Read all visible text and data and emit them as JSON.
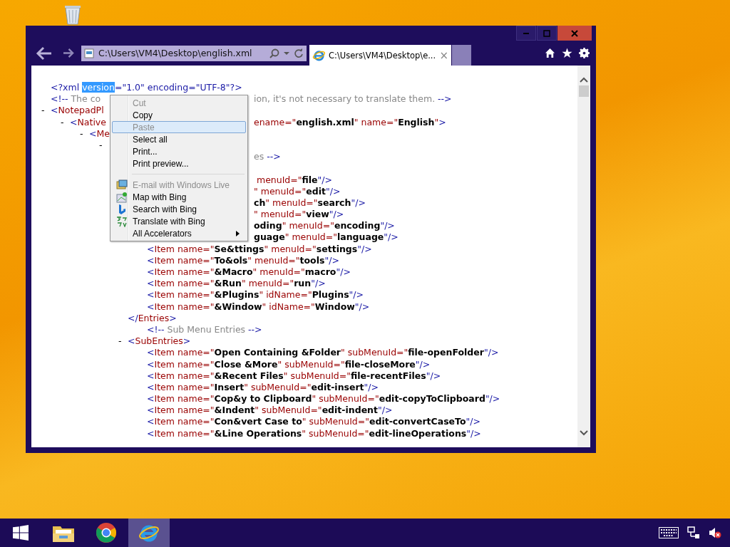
{
  "browser": {
    "address": "C:\\Users\\VM4\\Desktop\\english.xml",
    "tabs": [
      {
        "title": "C:\\Users\\VM4\\Desktop\\e...",
        "close": "×",
        "selected": true
      }
    ]
  },
  "document": {
    "nodes": [
      {
        "tokens": [
          {
            "kind": "markup",
            "text": "<?xml "
          },
          {
            "kind": "selection",
            "text": "version"
          },
          {
            "kind": "markup",
            "text": "=\"1.0\" encoding=\"UTF-8\"?>"
          }
        ]
      },
      {
        "tokens": [
          {
            "kind": "markup",
            "text": "<!--"
          },
          {
            "kind": "comment",
            "text": " The co"
          }
        ],
        "post": [
          {
            "kind": "comment",
            "text": "ion, it's not necessary to translate them. "
          },
          {
            "kind": "markup",
            "text": "-->"
          }
        ]
      },
      {
        "toggle": "-",
        "tokens": [
          {
            "kind": "markup",
            "text": "<"
          },
          {
            "kind": "name",
            "text": "NotepadPl"
          }
        ],
        "children": [
          {
            "toggle": "-",
            "tokens": [
              {
                "kind": "markup",
                "text": "<"
              },
              {
                "kind": "name",
                "text": "Native"
              }
            ],
            "post": [
              {
                "kind": "name",
                "text": "ename=\""
              },
              {
                "kind": "value",
                "text": "english.xml"
              },
              {
                "kind": "name",
                "text": "\" name=\""
              },
              {
                "kind": "value",
                "text": "English"
              },
              {
                "kind": "name",
                "text": "\""
              },
              {
                "kind": "markup",
                "text": ">"
              }
            ],
            "children": [
              {
                "toggle": "-",
                "tokens": [
                  {
                    "kind": "markup",
                    "text": "<"
                  },
                  {
                    "kind": "name",
                    "text": "Me"
                  }
                ],
                "children": [
                  {
                    "toggle": "-",
                    "children": [
                      {
                        "kind": "comment",
                        "post": [
                          {
                            "kind": "comment",
                            "text": "es "
                          },
                          {
                            "kind": "markup",
                            "text": "-->"
                          }
                        ]
                      },
                      {
                        "children": [
                          {
                            "post": [
                              {
                                "kind": "name",
                                "text": " menuId=\""
                              },
                              {
                                "kind": "value",
                                "text": "file"
                              },
                              {
                                "kind": "markup",
                                "text": "\"/>"
                              }
                            ]
                          },
                          {
                            "post": [
                              {
                                "kind": "name",
                                "text": "\" menuId=\""
                              },
                              {
                                "kind": "value",
                                "text": "edit"
                              },
                              {
                                "kind": "markup",
                                "text": "\"/>"
                              }
                            ]
                          },
                          {
                            "post": [
                              {
                                "kind": "value",
                                "text": "ch"
                              },
                              {
                                "kind": "name",
                                "text": "\" menuId=\""
                              },
                              {
                                "kind": "value",
                                "text": "search"
                              },
                              {
                                "kind": "markup",
                                "text": "\"/>"
                              }
                            ]
                          },
                          {
                            "post": [
                              {
                                "kind": "name",
                                "text": "\" menuId=\""
                              },
                              {
                                "kind": "value",
                                "text": "view"
                              },
                              {
                                "kind": "markup",
                                "text": "\"/>"
                              }
                            ]
                          },
                          {
                            "post": [
                              {
                                "kind": "value",
                                "text": "oding"
                              },
                              {
                                "kind": "name",
                                "text": "\" menuId=\""
                              },
                              {
                                "kind": "value",
                                "text": "encoding"
                              },
                              {
                                "kind": "markup",
                                "text": "\"/>"
                              }
                            ]
                          },
                          {
                            "post": [
                              {
                                "kind": "value",
                                "text": "guage"
                              },
                              {
                                "kind": "name",
                                "text": "\" menuId=\""
                              },
                              {
                                "kind": "value",
                                "text": "language"
                              },
                              {
                                "kind": "markup",
                                "text": "\"/>"
                              }
                            ]
                          },
                          {
                            "tokens": [
                              {
                                "kind": "markup",
                                "text": "<"
                              },
                              {
                                "kind": "name",
                                "text": "Item name=\""
                              },
                              {
                                "kind": "value",
                                "text": "Se&ttings"
                              },
                              {
                                "kind": "name",
                                "text": "\" menuId=\""
                              },
                              {
                                "kind": "value",
                                "text": "settings"
                              },
                              {
                                "kind": "markup",
                                "text": "\"/>"
                              }
                            ]
                          },
                          {
                            "tokens": [
                              {
                                "kind": "markup",
                                "text": "<"
                              },
                              {
                                "kind": "name",
                                "text": "Item name=\""
                              },
                              {
                                "kind": "value",
                                "text": "To&ols"
                              },
                              {
                                "kind": "name",
                                "text": "\" menuId=\""
                              },
                              {
                                "kind": "value",
                                "text": "tools"
                              },
                              {
                                "kind": "markup",
                                "text": "\"/>"
                              }
                            ]
                          },
                          {
                            "tokens": [
                              {
                                "kind": "markup",
                                "text": "<"
                              },
                              {
                                "kind": "name",
                                "text": "Item name=\""
                              },
                              {
                                "kind": "value",
                                "text": "&Macro"
                              },
                              {
                                "kind": "name",
                                "text": "\" menuId=\""
                              },
                              {
                                "kind": "value",
                                "text": "macro"
                              },
                              {
                                "kind": "markup",
                                "text": "\"/>"
                              }
                            ]
                          },
                          {
                            "tokens": [
                              {
                                "kind": "markup",
                                "text": "<"
                              },
                              {
                                "kind": "name",
                                "text": "Item name=\""
                              },
                              {
                                "kind": "value",
                                "text": "&Run"
                              },
                              {
                                "kind": "name",
                                "text": "\" menuId=\""
                              },
                              {
                                "kind": "value",
                                "text": "run"
                              },
                              {
                                "kind": "markup",
                                "text": "\"/>"
                              }
                            ]
                          },
                          {
                            "tokens": [
                              {
                                "kind": "markup",
                                "text": "<"
                              },
                              {
                                "kind": "name",
                                "text": "Item name=\""
                              },
                              {
                                "kind": "value",
                                "text": "&Plugins"
                              },
                              {
                                "kind": "name",
                                "text": "\" idName=\""
                              },
                              {
                                "kind": "value",
                                "text": "Plugins"
                              },
                              {
                                "kind": "markup",
                                "text": "\"/>"
                              }
                            ]
                          },
                          {
                            "tokens": [
                              {
                                "kind": "markup",
                                "text": "<"
                              },
                              {
                                "kind": "name",
                                "text": "Item name=\""
                              },
                              {
                                "kind": "value",
                                "text": "&Window"
                              },
                              {
                                "kind": "name",
                                "text": "\" idName=\""
                              },
                              {
                                "kind": "value",
                                "text": "Window"
                              },
                              {
                                "kind": "markup",
                                "text": "\"/>"
                              }
                            ]
                          }
                        ]
                      },
                      {
                        "tokens": [
                          {
                            "kind": "markup",
                            "text": "</"
                          },
                          {
                            "kind": "name",
                            "text": "Entries"
                          },
                          {
                            "kind": "markup",
                            "text": ">"
                          }
                        ]
                      },
                      {
                        "kind": "comment",
                        "tokens": [
                          {
                            "kind": "markup",
                            "text": "<!--"
                          },
                          {
                            "kind": "comment",
                            "text": " Sub Menu Entries "
                          },
                          {
                            "kind": "markup",
                            "text": "-->"
                          }
                        ]
                      },
                      {
                        "toggle": "-",
                        "tokens": [
                          {
                            "kind": "markup",
                            "text": "<"
                          },
                          {
                            "kind": "name",
                            "text": "SubEntries"
                          },
                          {
                            "kind": "markup",
                            "text": ">"
                          }
                        ],
                        "children": [
                          {
                            "tokens": [
                              {
                                "kind": "markup",
                                "text": "<"
                              },
                              {
                                "kind": "name",
                                "text": "Item name=\""
                              },
                              {
                                "kind": "value",
                                "text": "Open Containing &Folder"
                              },
                              {
                                "kind": "name",
                                "text": "\" subMenuId=\""
                              },
                              {
                                "kind": "value",
                                "text": "file-openFolder"
                              },
                              {
                                "kind": "markup",
                                "text": "\"/>"
                              }
                            ]
                          },
                          {
                            "tokens": [
                              {
                                "kind": "markup",
                                "text": "<"
                              },
                              {
                                "kind": "name",
                                "text": "Item name=\""
                              },
                              {
                                "kind": "value",
                                "text": "Close &More"
                              },
                              {
                                "kind": "name",
                                "text": "\" subMenuId=\""
                              },
                              {
                                "kind": "value",
                                "text": "file-closeMore"
                              },
                              {
                                "kind": "markup",
                                "text": "\"/>"
                              }
                            ]
                          },
                          {
                            "tokens": [
                              {
                                "kind": "markup",
                                "text": "<"
                              },
                              {
                                "kind": "name",
                                "text": "Item name=\""
                              },
                              {
                                "kind": "value",
                                "text": "&Recent Files"
                              },
                              {
                                "kind": "name",
                                "text": "\" subMenuId=\""
                              },
                              {
                                "kind": "value",
                                "text": "file-recentFiles"
                              },
                              {
                                "kind": "markup",
                                "text": "\"/>"
                              }
                            ]
                          },
                          {
                            "tokens": [
                              {
                                "kind": "markup",
                                "text": "<"
                              },
                              {
                                "kind": "name",
                                "text": "Item name=\""
                              },
                              {
                                "kind": "value",
                                "text": "Insert"
                              },
                              {
                                "kind": "name",
                                "text": "\" subMenuId=\""
                              },
                              {
                                "kind": "value",
                                "text": "edit-insert"
                              },
                              {
                                "kind": "markup",
                                "text": "\"/>"
                              }
                            ]
                          },
                          {
                            "tokens": [
                              {
                                "kind": "markup",
                                "text": "<"
                              },
                              {
                                "kind": "name",
                                "text": "Item name=\""
                              },
                              {
                                "kind": "value",
                                "text": "Cop&y to Clipboard"
                              },
                              {
                                "kind": "name",
                                "text": "\" subMenuId=\""
                              },
                              {
                                "kind": "value",
                                "text": "edit-copyToClipboard"
                              },
                              {
                                "kind": "markup",
                                "text": "\"/>"
                              }
                            ]
                          },
                          {
                            "tokens": [
                              {
                                "kind": "markup",
                                "text": "<"
                              },
                              {
                                "kind": "name",
                                "text": "Item name=\""
                              },
                              {
                                "kind": "value",
                                "text": "&Indent"
                              },
                              {
                                "kind": "name",
                                "text": "\" subMenuId=\""
                              },
                              {
                                "kind": "value",
                                "text": "edit-indent"
                              },
                              {
                                "kind": "markup",
                                "text": "\"/>"
                              }
                            ]
                          },
                          {
                            "tokens": [
                              {
                                "kind": "markup",
                                "text": "<"
                              },
                              {
                                "kind": "name",
                                "text": "Item name=\""
                              },
                              {
                                "kind": "value",
                                "text": "Con&vert Case to"
                              },
                              {
                                "kind": "name",
                                "text": "\" subMenuId=\""
                              },
                              {
                                "kind": "value",
                                "text": "edit-convertCaseTo"
                              },
                              {
                                "kind": "markup",
                                "text": "\"/>"
                              }
                            ]
                          },
                          {
                            "tokens": [
                              {
                                "kind": "markup",
                                "text": "<"
                              },
                              {
                                "kind": "name",
                                "text": "Item name=\""
                              },
                              {
                                "kind": "value",
                                "text": "&Line Operations"
                              },
                              {
                                "kind": "name",
                                "text": "\" subMenuId=\""
                              },
                              {
                                "kind": "value",
                                "text": "edit-lineOperations"
                              },
                              {
                                "kind": "markup",
                                "text": "\"/>"
                              }
                            ]
                          }
                        ]
                      }
                    ]
                  }
                ]
              }
            ]
          }
        ]
      }
    ]
  },
  "context_menu": {
    "items": [
      {
        "kind": "plain",
        "label": "Cut",
        "disabled": true,
        "selected": false
      },
      {
        "kind": "plain",
        "label": "Copy",
        "disabled": false,
        "selected": false
      },
      {
        "kind": "plain",
        "label": "Paste",
        "disabled": true,
        "selected": true
      },
      {
        "kind": "plain",
        "label": "Select all",
        "disabled": false,
        "selected": false
      },
      {
        "kind": "plain",
        "label": "Print...",
        "disabled": false,
        "selected": false
      },
      {
        "kind": "plain",
        "label": "Print preview...",
        "disabled": false,
        "selected": false
      },
      {
        "kind": "separator"
      },
      {
        "kind": "mail",
        "label": "E-mail with Windows Live",
        "disabled": true,
        "selected": false
      },
      {
        "kind": "map",
        "label": "Map with Bing",
        "disabled": false,
        "selected": false
      },
      {
        "kind": "search",
        "label": "Search with Bing",
        "disabled": false,
        "selected": false
      },
      {
        "kind": "translate",
        "label": "Translate with Bing",
        "disabled": false,
        "selected": false
      },
      {
        "kind": "submenu",
        "label": "All Accelerators",
        "disabled": false,
        "selected": false
      }
    ]
  },
  "taskbar": {
    "items": [
      {
        "kind": "start",
        "selected": false
      },
      {
        "kind": "folder",
        "selected": false
      },
      {
        "kind": "chrome",
        "selected": false
      },
      {
        "kind": "ie",
        "selected": true
      }
    ],
    "tray": [
      {
        "kind": "keyboard"
      },
      {
        "kind": "network"
      },
      {
        "kind": "muted"
      }
    ]
  }
}
